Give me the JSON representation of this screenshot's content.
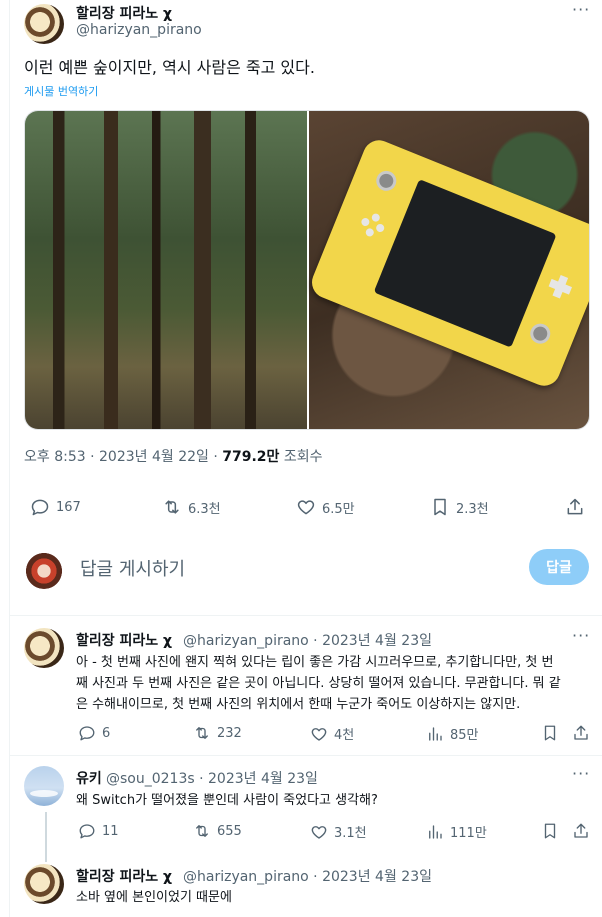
{
  "tweet": {
    "author_name": "할리장 피라노 χ",
    "handle": "@harizyan_pirano",
    "more": "···",
    "text": "이런 예쁜 숲이지만, 역시 사람은 죽고 있다.",
    "translate_label": "게시물 번역하기",
    "time": "오후 8:53 · 2023년 4월 22일 · ",
    "views_value": "779.2만",
    "views_label": " 조회수",
    "actions": {
      "replies": "167",
      "retweets": "6.3천",
      "likes": "6.5만",
      "bookmarks": "2.3천"
    }
  },
  "compose": {
    "placeholder": "답글 게시하기",
    "button": "답글"
  },
  "replies": [
    {
      "author_name": "할리장 피라노 χ",
      "handle_date": "@harizyan_pirano · 2023년 4월 23일",
      "text_lines": [
        "아 - 첫 번째 사진에 왠지 찍혀 있다는 립이 좋은 가감 시끄러우므로, 추기합니다만, 첫 번",
        "째 사진과 두 번째 사진은 같은 곳이 아닙니다. 상당히 떨어져 있습니다. 무관합니다. 뭐 같",
        "은 수해내이므로, 첫 번째 사진의 위치에서 한때 누군가 죽어도 이상하지는 않지만."
      ],
      "replies": "6",
      "retweets": "232",
      "likes": "4천",
      "views": "85만"
    },
    {
      "author_name": "유키",
      "handle_date": "@sou_0213s · 2023년 4월 23일",
      "text_lines": [
        "왜 Switch가 떨어졌을 뿐인데 사람이 죽었다고 생각해?"
      ],
      "replies": "11",
      "retweets": "655",
      "likes": "3.1천",
      "views": "111만"
    },
    {
      "author_name": "할리장 피라노 χ",
      "handle_date": "@harizyan_pirano · 2023년 4월 23일",
      "text_lines": [
        "소바 옆에 본인이었기 때문에"
      ]
    }
  ]
}
